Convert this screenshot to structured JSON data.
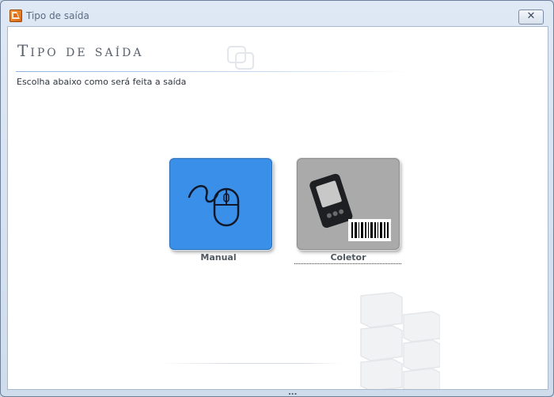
{
  "window": {
    "title": "Tipo de saída",
    "close_label": "✕",
    "app_icon": "app-orange-icon"
  },
  "header": {
    "title": "Tipo de saída",
    "subtitle": "Escolha abaixo como será feita a saída"
  },
  "options": [
    {
      "label": "Manual",
      "icon": "mouse-icon",
      "color": "#3a8fe8",
      "selected": true
    },
    {
      "label": "Coletor",
      "icon": "barcode-collector-icon",
      "color": "#aaaaaa",
      "focused": true
    }
  ],
  "background": {
    "behind_text": "...",
    "watermark_icon": "server-stack-icon"
  }
}
